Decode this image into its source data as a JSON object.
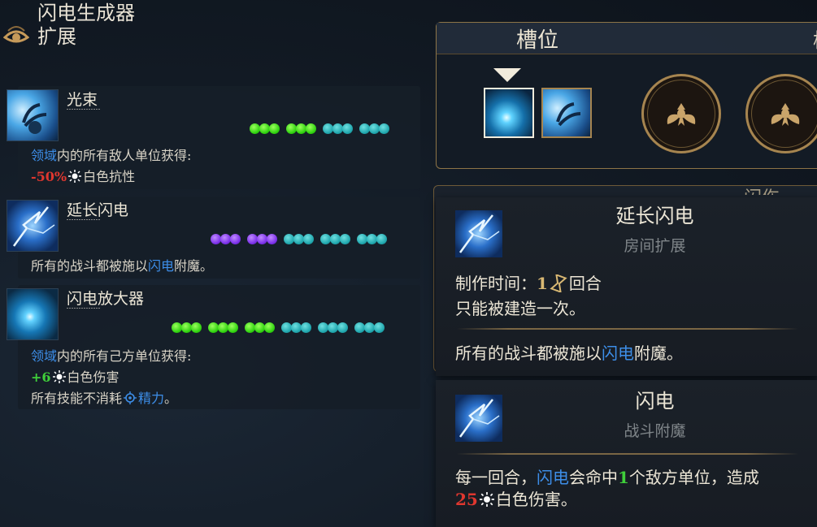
{
  "header": {
    "title": "闪电生成器",
    "subtitle": "扩展"
  },
  "cards": [
    {
      "name": "光束",
      "line1_a": "领域",
      "line1_b": "内的所有敌人单位获得:",
      "line2_val": "-50%",
      "line2_txt": "白色抗性"
    },
    {
      "name": "延长闪电",
      "line1_a": "所有的战斗都被施以",
      "line1_b": "闪电",
      "line1_c": "附魔。"
    },
    {
      "name": "闪电放大器",
      "line1_a": "领域",
      "line1_b": "内的所有己方单位获得:",
      "line2_val": "+6",
      "line2_txt": "白色伤害",
      "line3_a": "所有技能不消耗",
      "line3_b": "精力",
      "line3_c": "。"
    }
  ],
  "slot_panel": {
    "title": "槽位",
    "title_cut": "槽"
  },
  "panel2": {
    "title_cut": "闪伤"
  },
  "tooltip1": {
    "title": "延长闪电",
    "subtitle": "房间扩展",
    "craft_label": "制作时间：",
    "craft_val": "1",
    "craft_unit": "回合",
    "once": "只能被建造一次。",
    "desc_a": "所有的战斗都被施以",
    "desc_b": "闪电",
    "desc_c": "附魔。"
  },
  "tooltip2": {
    "title": "闪电",
    "subtitle": "战斗附魔",
    "desc_a": "每一回合，",
    "desc_b": "闪电",
    "desc_c": "会命中",
    "desc_d": "1",
    "desc_e": "个敌方单位，造成",
    "desc_val": "25",
    "desc_f": "白色伤害。"
  },
  "colors": {
    "accent_gold": "#8d7447",
    "green_dot": "#2ed20f",
    "teal_dot": "#1fa6ad",
    "purple_dot": "#7a2fe8",
    "link_blue": "#3d8ee8",
    "neg_red": "#e0372f"
  },
  "icons": [
    "eye-sigil-icon",
    "sun-icon",
    "hourglass-icon",
    "stamina-icon",
    "beetle-icon"
  ]
}
